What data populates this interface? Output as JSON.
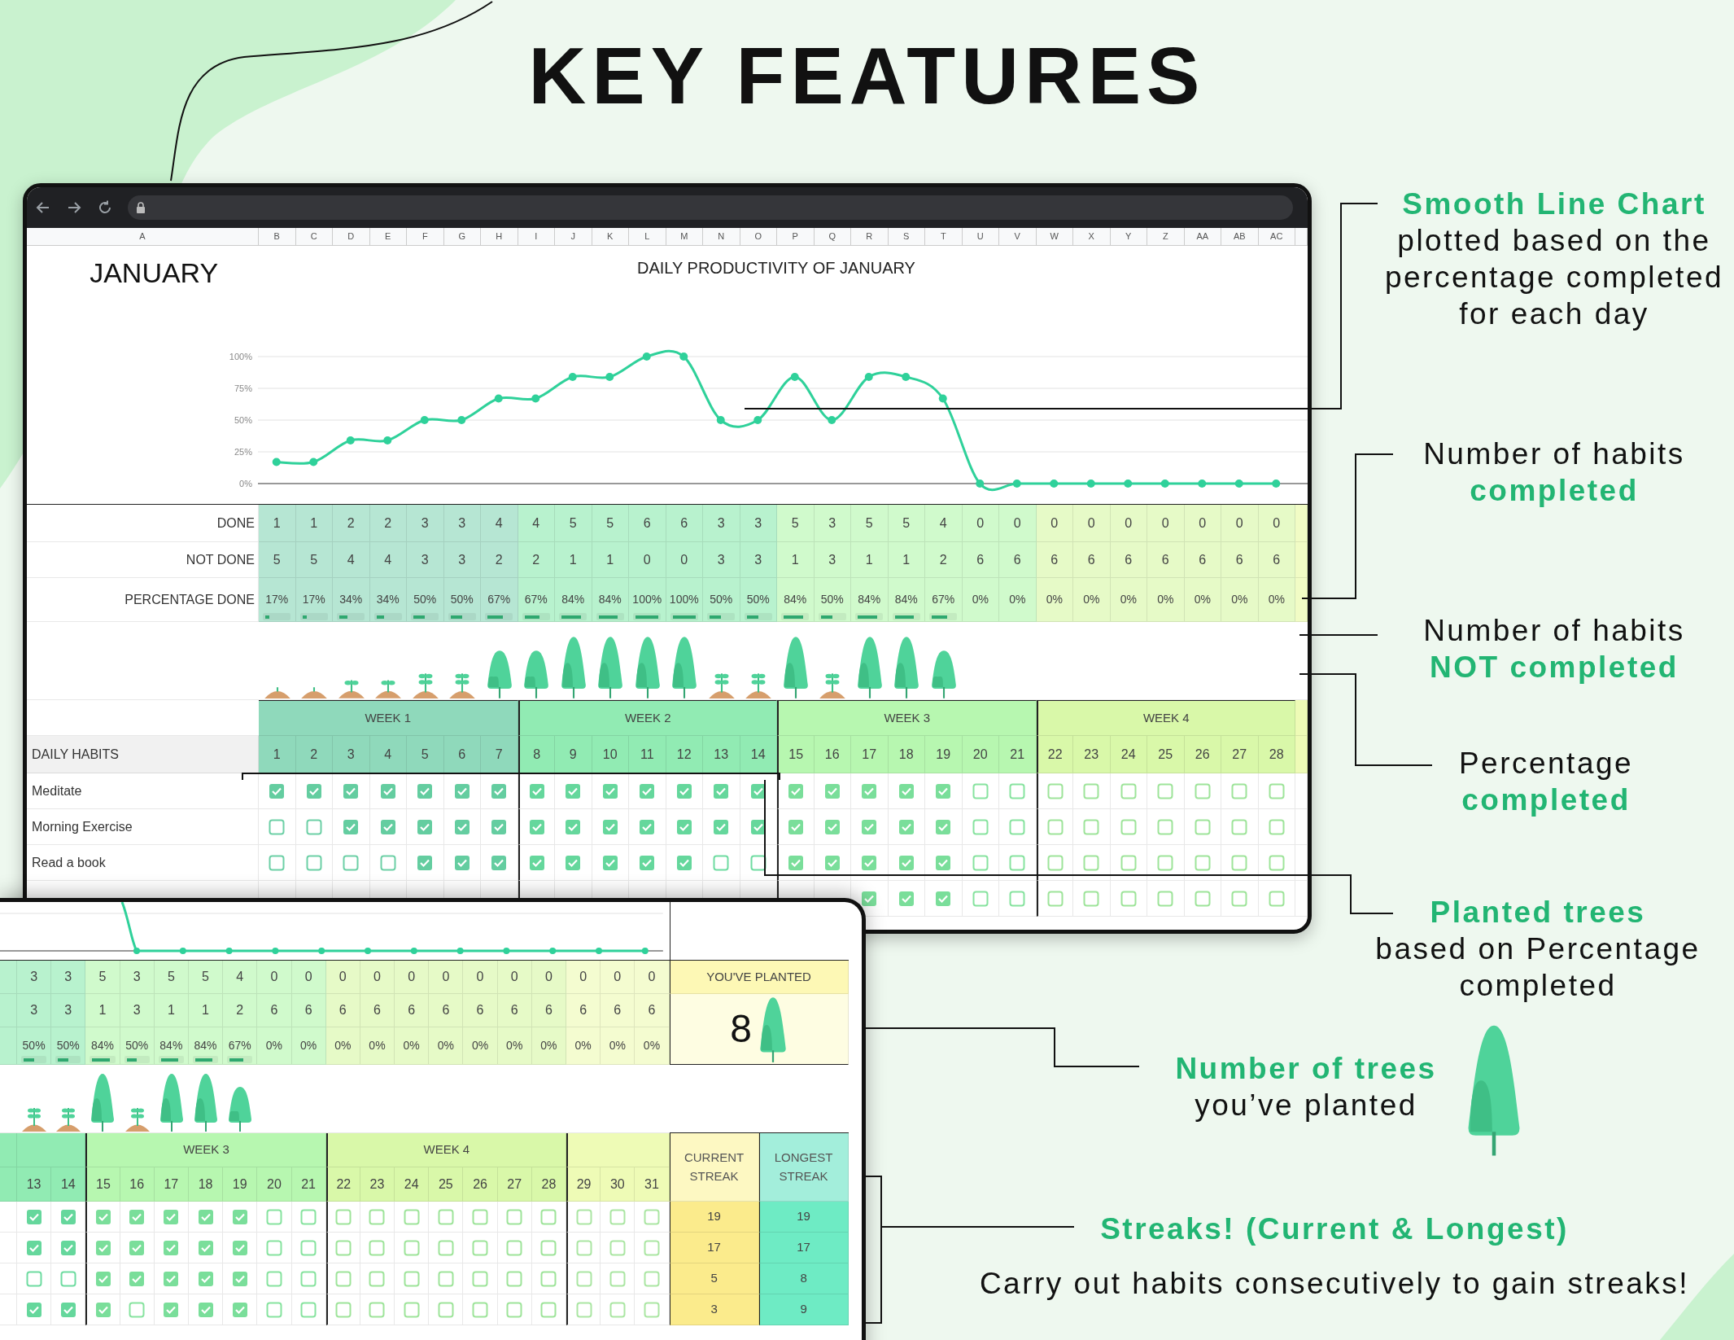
{
  "title": "KEY FEATURES",
  "main_window": {
    "columns": [
      "A",
      "B",
      "C",
      "D",
      "E",
      "F",
      "G",
      "H",
      "I",
      "J",
      "K",
      "L",
      "M",
      "N",
      "O",
      "P",
      "Q",
      "R",
      "S",
      "T",
      "U",
      "V",
      "W",
      "X",
      "Y",
      "Z",
      "AA",
      "AB",
      "AC"
    ],
    "month": "JANUARY",
    "chart_data": {
      "type": "line",
      "title": "DAILY PRODUCTIVITY OF JANUARY",
      "ylim": [
        0,
        100
      ],
      "grid": true,
      "yticks": [
        {
          "value": 0,
          "label": "0%"
        },
        {
          "value": 25,
          "label": "25%"
        },
        {
          "value": 50,
          "label": "50%"
        },
        {
          "value": 75,
          "label": "75%"
        },
        {
          "value": 100,
          "label": "100%"
        }
      ],
      "series": [
        {
          "color": "#2fd19a",
          "marker": "circle",
          "values": [
            17,
            17,
            34,
            34,
            50,
            50,
            67,
            67,
            84,
            84,
            100,
            100,
            50,
            50,
            84,
            50,
            84,
            84,
            67,
            0,
            0,
            0,
            0,
            0,
            0,
            0,
            0,
            0
          ]
        }
      ]
    },
    "row_labels": {
      "done": "DONE",
      "not_done": "NOT DONE",
      "percentage": "PERCENTAGE DONE",
      "habits": "DAILY HABITS"
    },
    "days": [
      {
        "done": "1",
        "not_done": "5",
        "percentage": "17%",
        "level": 0.17,
        "kind": "seed"
      },
      {
        "done": "1",
        "not_done": "5",
        "percentage": "17%",
        "level": 0.17,
        "kind": "seed"
      },
      {
        "done": "2",
        "not_done": "4",
        "percentage": "34%",
        "level": 0.34,
        "kind": "sprout"
      },
      {
        "done": "2",
        "not_done": "4",
        "percentage": "34%",
        "level": 0.34,
        "kind": "sprout"
      },
      {
        "done": "3",
        "not_done": "3",
        "percentage": "50%",
        "level": 0.5,
        "kind": "sapling"
      },
      {
        "done": "3",
        "not_done": "3",
        "percentage": "50%",
        "level": 0.5,
        "kind": "sapling"
      },
      {
        "done": "4",
        "not_done": "2",
        "percentage": "67%",
        "level": 0.67,
        "kind": "young-tree"
      },
      {
        "done": "4",
        "not_done": "2",
        "percentage": "67%",
        "level": 0.67,
        "kind": "young-tree"
      },
      {
        "done": "5",
        "not_done": "1",
        "percentage": "84%",
        "level": 0.84,
        "kind": "tree"
      },
      {
        "done": "5",
        "not_done": "1",
        "percentage": "84%",
        "level": 0.84,
        "kind": "tree"
      },
      {
        "done": "6",
        "not_done": "0",
        "percentage": "100%",
        "level": 1,
        "kind": "tree"
      },
      {
        "done": "6",
        "not_done": "0",
        "percentage": "100%",
        "level": 1,
        "kind": "tree"
      },
      {
        "done": "3",
        "not_done": "3",
        "percentage": "50%",
        "level": 0.5,
        "kind": "sapling"
      },
      {
        "done": "3",
        "not_done": "3",
        "percentage": "50%",
        "level": 0.5,
        "kind": "sapling"
      },
      {
        "done": "5",
        "not_done": "1",
        "percentage": "84%",
        "level": 0.84,
        "kind": "tree"
      },
      {
        "done": "3",
        "not_done": "3",
        "percentage": "50%",
        "level": 0.5,
        "kind": "sapling"
      },
      {
        "done": "5",
        "not_done": "1",
        "percentage": "84%",
        "level": 0.84,
        "kind": "tree"
      },
      {
        "done": "5",
        "not_done": "1",
        "percentage": "84%",
        "level": 0.84,
        "kind": "tree"
      },
      {
        "done": "4",
        "not_done": "2",
        "percentage": "67%",
        "level": 0.67,
        "kind": "young-tree"
      },
      {
        "done": "0",
        "not_done": "6",
        "percentage": "0%"
      },
      {
        "done": "0",
        "not_done": "6",
        "percentage": "0%"
      },
      {
        "done": "0",
        "not_done": "6",
        "percentage": "0%"
      },
      {
        "done": "0",
        "not_done": "6",
        "percentage": "0%"
      },
      {
        "done": "0",
        "not_done": "6",
        "percentage": "0%"
      },
      {
        "done": "0",
        "not_done": "6",
        "percentage": "0%"
      },
      {
        "done": "0",
        "not_done": "6",
        "percentage": "0%"
      },
      {
        "done": "0",
        "not_done": "6",
        "percentage": "0%"
      },
      {
        "done": "0",
        "not_done": "6",
        "percentage": "0%"
      }
    ],
    "weeks": [
      {
        "label": "WEEK 1",
        "color": "#8fd9bb",
        "days": [
          "1",
          "2",
          "3",
          "4",
          "5",
          "6",
          "7"
        ]
      },
      {
        "label": "WEEK 2",
        "color": "#91ebb3",
        "days": [
          "8",
          "9",
          "10",
          "11",
          "12",
          "13",
          "14"
        ]
      },
      {
        "label": "WEEK 3",
        "color": "#b7f7b0",
        "days": [
          "15",
          "16",
          "17",
          "18",
          "19",
          "20",
          "21"
        ]
      },
      {
        "label": "WEEK 4",
        "color": "#d9f8a9",
        "days": [
          "22",
          "23",
          "24",
          "25",
          "26",
          "27",
          "28"
        ]
      }
    ],
    "habits": [
      {
        "name": "Meditate",
        "checks": [
          true,
          true,
          true,
          true,
          true,
          true,
          true,
          true,
          true,
          true,
          true,
          true,
          true,
          true,
          true,
          true,
          true,
          true,
          true,
          false,
          false,
          false,
          false,
          false,
          false,
          false,
          false,
          false
        ]
      },
      {
        "name": "Morning Exercise",
        "checks": [
          false,
          false,
          true,
          true,
          true,
          true,
          true,
          true,
          true,
          true,
          true,
          true,
          true,
          true,
          true,
          true,
          true,
          true,
          true,
          false,
          false,
          false,
          false,
          false,
          false,
          false,
          false,
          false
        ]
      },
      {
        "name": "Read a book",
        "checks": [
          false,
          false,
          false,
          false,
          true,
          true,
          true,
          true,
          true,
          true,
          true,
          true,
          false,
          false,
          true,
          true,
          true,
          true,
          true,
          false,
          false,
          false,
          false,
          false,
          false,
          false,
          false,
          false
        ]
      },
      {
        "checks": [
          true,
          true,
          true,
          false,
          false,
          false,
          false,
          false,
          false,
          false,
          false,
          false
        ]
      }
    ]
  },
  "second_window": {
    "days": [
      {
        "done": "3",
        "not_done": "3",
        "percentage": "50%",
        "level": 0.5,
        "kind": "sapling"
      },
      {
        "done": "3",
        "not_done": "3",
        "percentage": "50%",
        "level": 0.5,
        "kind": "sapling"
      },
      {
        "done": "5",
        "not_done": "1",
        "percentage": "84%",
        "level": 0.84,
        "kind": "tree"
      },
      {
        "done": "3",
        "not_done": "3",
        "percentage": "50%",
        "level": 0.5,
        "kind": "sapling"
      },
      {
        "done": "5",
        "not_done": "1",
        "percentage": "84%",
        "level": 0.84,
        "kind": "tree"
      },
      {
        "done": "5",
        "not_done": "1",
        "percentage": "84%",
        "level": 0.84,
        "kind": "tree"
      },
      {
        "done": "4",
        "not_done": "2",
        "percentage": "67%",
        "level": 0.67,
        "kind": "young-tree"
      },
      {
        "done": "0",
        "not_done": "6",
        "percentage": "0%"
      },
      {
        "done": "0",
        "not_done": "6",
        "percentage": "0%"
      },
      {
        "done": "0",
        "not_done": "6",
        "percentage": "0%"
      },
      {
        "done": "0",
        "not_done": "6",
        "percentage": "0%"
      },
      {
        "done": "0",
        "not_done": "6",
        "percentage": "0%"
      },
      {
        "done": "0",
        "not_done": "6",
        "percentage": "0%"
      },
      {
        "done": "0",
        "not_done": "6",
        "percentage": "0%"
      },
      {
        "done": "0",
        "not_done": "6",
        "percentage": "0%"
      },
      {
        "done": "0",
        "not_done": "6",
        "percentage": "0%"
      },
      {
        "done": "0",
        "not_done": "6",
        "percentage": "0%"
      },
      {
        "done": "0",
        "not_done": "6",
        "percentage": "0%"
      },
      {
        "done": "0",
        "not_done": "6",
        "percentage": "0%"
      }
    ],
    "weeks": [
      {
        "color": "#91ebb3",
        "days": [
          "13",
          "14"
        ]
      },
      {
        "label": "WEEK 3",
        "color": "#b7f7b0",
        "days": [
          "15",
          "16",
          "17",
          "18",
          "19",
          "20",
          "21"
        ]
      },
      {
        "label": "WEEK 4",
        "color": "#d9f8a9",
        "days": [
          "22",
          "23",
          "24",
          "25",
          "26",
          "27",
          "28"
        ]
      },
      {
        "color": "#eefbb6",
        "days": [
          "29",
          "30",
          "31"
        ]
      }
    ],
    "planted": {
      "label": "YOU'VE PLANTED",
      "count": "8"
    },
    "streak_headers": {
      "current": "CURRENT STREAK",
      "longest": "LONGEST STREAK"
    },
    "habits": [
      {
        "checks": [
          true,
          true,
          true,
          true,
          true,
          true,
          true,
          false,
          false,
          false,
          false,
          false,
          false,
          false,
          false,
          false,
          false,
          false,
          false
        ],
        "current_streak": "19",
        "longest_streak": "19"
      },
      {
        "checks": [
          true,
          true,
          true,
          true,
          true,
          true,
          true,
          false,
          false,
          false,
          false,
          false,
          false,
          false,
          false,
          false,
          false,
          false,
          false
        ],
        "current_streak": "17",
        "longest_streak": "17"
      },
      {
        "checks": [
          false,
          false,
          true,
          true,
          true,
          true,
          true,
          false,
          false,
          false,
          false,
          false,
          false,
          false,
          false,
          false,
          false,
          false,
          false
        ],
        "current_streak": "5",
        "longest_streak": "8"
      },
      {
        "checks": [
          true,
          true,
          true,
          false,
          true,
          true,
          true,
          false,
          false,
          false,
          false,
          false,
          false,
          false,
          false,
          false,
          false,
          false,
          false
        ],
        "current_streak": "3",
        "longest_streak": "9"
      }
    ]
  },
  "annotations": [
    {
      "kind": "text",
      "parts": [
        {
          "text": "Smooth Line Chart",
          "emphasis": true
        },
        {
          "text": "plotted based on the\npercentage completed\nfor each day",
          "emphasis": false
        }
      ]
    },
    {
      "kind": "text",
      "parts": [
        {
          "text": "Number of habits",
          "emphasis": false
        },
        {
          "text": "completed",
          "emphasis": true
        }
      ]
    },
    {
      "kind": "text",
      "parts": [
        {
          "text": "Number of habits",
          "emphasis": false
        },
        {
          "text": "NOT completed",
          "emphasis": true
        }
      ]
    },
    {
      "kind": "text",
      "parts": [
        {
          "text": "Percentage",
          "emphasis": false
        },
        {
          "text": "completed",
          "emphasis": true
        }
      ]
    },
    {
      "kind": "text",
      "parts": [
        {
          "text": "Planted trees",
          "emphasis": true
        },
        {
          "text": "based on Percentage\ncompleted",
          "emphasis": false
        }
      ]
    },
    {
      "kind": "figure",
      "parts": [
        {
          "text": "Number of trees",
          "emphasis": true
        },
        {
          "text": "you’ve planted",
          "emphasis": false
        }
      ]
    },
    {
      "kind": "text",
      "parts": [
        {
          "text": "Streaks! (Current & Longest)",
          "emphasis": true
        },
        {
          "text": "Carry out habits consecutively to gain streaks!",
          "emphasis": false
        }
      ]
    }
  ]
}
